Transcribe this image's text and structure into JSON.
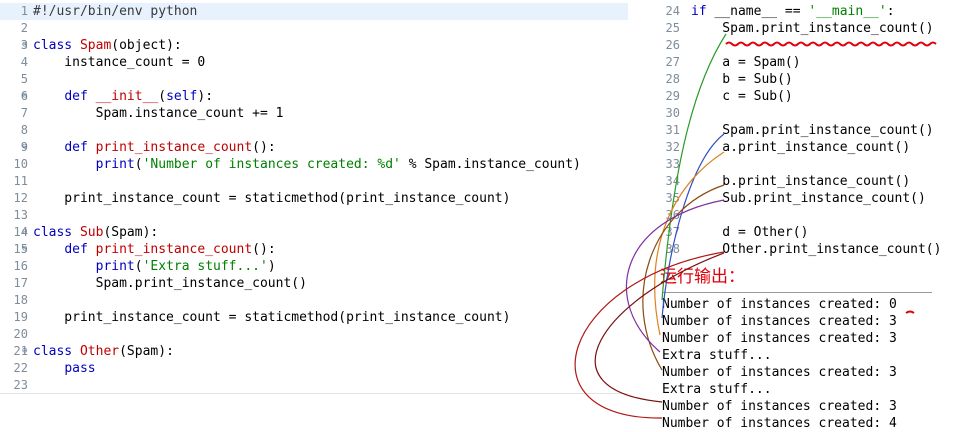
{
  "left_editor": {
    "lines": [
      {
        "num": "1",
        "fold": "",
        "html": "#!/usr/bin/env python",
        "cls": "hl"
      },
      {
        "num": "2",
        "fold": "",
        "text": ""
      },
      {
        "num": "3",
        "fold": "⊖",
        "segs": [
          [
            "kw",
            "class "
          ],
          [
            "cls",
            "Spam"
          ],
          [
            "",
            "(object):"
          ]
        ]
      },
      {
        "num": "4",
        "fold": "",
        "segs": [
          [
            "",
            "    instance_count = 0"
          ]
        ]
      },
      {
        "num": "5",
        "fold": "",
        "text": ""
      },
      {
        "num": "6",
        "fold": "⊖",
        "segs": [
          [
            "",
            "    "
          ],
          [
            "kw",
            "def "
          ],
          [
            "fn",
            "__init__"
          ],
          [
            "",
            "("
          ],
          [
            "kw",
            "self"
          ],
          [
            "",
            "):"
          ]
        ]
      },
      {
        "num": "7",
        "fold": "",
        "segs": [
          [
            "",
            "        Spam.instance_count += 1"
          ]
        ]
      },
      {
        "num": "8",
        "fold": "",
        "text": ""
      },
      {
        "num": "9",
        "fold": "⊖",
        "segs": [
          [
            "",
            "    "
          ],
          [
            "kw",
            "def "
          ],
          [
            "fn",
            "print_instance_count"
          ],
          [
            "",
            "():"
          ]
        ]
      },
      {
        "num": "10",
        "fold": "",
        "segs": [
          [
            "",
            "        "
          ],
          [
            "kw",
            "print"
          ],
          [
            "",
            "("
          ],
          [
            "str",
            "'Number of instances created: %d'"
          ],
          [
            "",
            " % Spam.instance_count)"
          ]
        ]
      },
      {
        "num": "11",
        "fold": "",
        "text": ""
      },
      {
        "num": "12",
        "fold": "",
        "segs": [
          [
            "",
            "    print_instance_count = staticmethod(print_instance_count)"
          ]
        ]
      },
      {
        "num": "13",
        "fold": "",
        "text": ""
      },
      {
        "num": "14",
        "fold": "⊖",
        "segs": [
          [
            "kw",
            "class "
          ],
          [
            "cls",
            "Sub"
          ],
          [
            "",
            "(Spam):"
          ]
        ]
      },
      {
        "num": "15",
        "fold": "⊖",
        "segs": [
          [
            "",
            "    "
          ],
          [
            "kw",
            "def "
          ],
          [
            "fn",
            "print_instance_count"
          ],
          [
            "",
            "():"
          ]
        ]
      },
      {
        "num": "16",
        "fold": "",
        "segs": [
          [
            "",
            "        "
          ],
          [
            "kw",
            "print"
          ],
          [
            "",
            "("
          ],
          [
            "str",
            "'Extra stuff...'"
          ],
          [
            "",
            ")"
          ]
        ]
      },
      {
        "num": "17",
        "fold": "",
        "segs": [
          [
            "",
            "        Spam.print_instance_count()"
          ]
        ]
      },
      {
        "num": "18",
        "fold": "",
        "text": ""
      },
      {
        "num": "19",
        "fold": "",
        "segs": [
          [
            "",
            "    print_instance_count = staticmethod(print_instance_count)"
          ]
        ]
      },
      {
        "num": "20",
        "fold": "",
        "text": ""
      },
      {
        "num": "21",
        "fold": "⊖",
        "segs": [
          [
            "kw",
            "class "
          ],
          [
            "cls",
            "Other"
          ],
          [
            "",
            "(Spam):"
          ]
        ]
      },
      {
        "num": "22",
        "fold": "",
        "segs": [
          [
            "",
            "    "
          ],
          [
            "kw",
            "pass"
          ]
        ]
      },
      {
        "num": "23",
        "fold": "",
        "text": ""
      }
    ]
  },
  "right_editor": {
    "lines": [
      {
        "num": "24",
        "segs": [
          [
            "kw",
            "if "
          ],
          [
            "",
            "__name__ == "
          ],
          [
            "str",
            "'__main__'"
          ],
          [
            "",
            ":"
          ]
        ]
      },
      {
        "num": "25",
        "segs": [
          [
            "",
            "    Spam.print_instance_count()"
          ]
        ]
      },
      {
        "num": "26",
        "segs": [
          [
            "",
            ""
          ]
        ]
      },
      {
        "num": "27",
        "segs": [
          [
            "",
            "    a = Spam()"
          ]
        ]
      },
      {
        "num": "28",
        "segs": [
          [
            "",
            "    b = Sub()"
          ]
        ]
      },
      {
        "num": "29",
        "segs": [
          [
            "",
            "    c = Sub()"
          ]
        ]
      },
      {
        "num": "30",
        "segs": [
          [
            "",
            ""
          ]
        ]
      },
      {
        "num": "31",
        "segs": [
          [
            "",
            "    Spam.print_instance_count()"
          ]
        ]
      },
      {
        "num": "32",
        "segs": [
          [
            "",
            "    a.print_instance_count()"
          ]
        ]
      },
      {
        "num": "33",
        "segs": [
          [
            "",
            ""
          ]
        ]
      },
      {
        "num": "34",
        "segs": [
          [
            "",
            "    b.print_instance_count()"
          ]
        ]
      },
      {
        "num": "35",
        "segs": [
          [
            "",
            "    Sub.print_instance_count()"
          ]
        ]
      },
      {
        "num": "36",
        "segs": [
          [
            "",
            ""
          ]
        ]
      },
      {
        "num": "37",
        "segs": [
          [
            "",
            "    d = Other()"
          ]
        ]
      },
      {
        "num": "38",
        "segs": [
          [
            "",
            "    Other.print_instance_count()"
          ]
        ]
      }
    ]
  },
  "output": {
    "title": "运行输出：",
    "lines": [
      "Number of instances created: 0",
      "Number of instances created: 3",
      "Number of instances created: 3",
      "Extra stuff...",
      "Number of instances created: 3",
      "Extra stuff...",
      "Number of instances created: 3",
      "Number of instances created: 4"
    ]
  },
  "colors": {
    "accent_red": "#e0000a",
    "keyword_blue": "#0000c0",
    "string_green": "#008000",
    "gutter_gray": "#7f8c99"
  }
}
